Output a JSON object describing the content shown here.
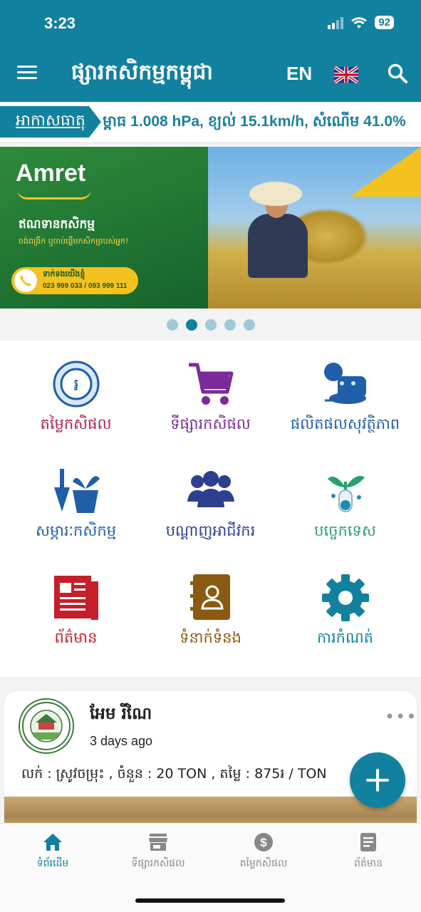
{
  "status_bar": {
    "time": "3:23",
    "battery": "92"
  },
  "header": {
    "title": "ផ្សារកសិកម្មកម្ពុជា",
    "language": "EN"
  },
  "ticker": {
    "label": "អាកាសធាតុ",
    "text": "ម្ពាធ 1.008 hPa, ខ្យល់ 15.1km/h, សំណើម 41.0%"
  },
  "banner": {
    "logo": "Amret",
    "heading": "ឥណទានកសិកម្ម",
    "subheading": "ចង់ពង្រីក ឬចាប់ផ្ដើមកសិកម្មរបស់អ្នក!",
    "call_label": "ទាក់ទងយើងខ្ញុំ",
    "call_numbers": "023 999 033 / 093 999 111",
    "slides": 5,
    "active_slide": 2
  },
  "menu": [
    {
      "label": "តម្លៃកសិផល",
      "color": "#b11f4b"
    },
    {
      "label": "ទីផ្សារកសិផល",
      "color": "#7b2a9a"
    },
    {
      "label": "ផលិតផលសុវត្ថិភាព",
      "color": "#1f5ea8"
    },
    {
      "label": "សម្ភារៈកសិកម្ម",
      "color": "#1f5ea8"
    },
    {
      "label": "បណ្ដាញអាជីវករ",
      "color": "#2d3f8f"
    },
    {
      "label": "បច្ចេកទេស",
      "color": "#27a06e"
    },
    {
      "label": "ព័ត៌មាន",
      "color": "#c41f2a"
    },
    {
      "label": "ទំនាក់ទំនង",
      "color": "#8a5a12"
    },
    {
      "label": "ការកំណត់",
      "color": "#11819f"
    }
  ],
  "post": {
    "author": "អែម រីណៃ",
    "time": "3 days ago",
    "content": "លក់ : ស្រូវចម្រុះ , ចំនួន : 20 TON , តម្លៃ : 875៛ / TON",
    "more": "•••"
  },
  "bottom_nav": [
    {
      "label": "ទំព័រដើម",
      "active": true
    },
    {
      "label": "ទីផ្សារកសិផល",
      "active": false
    },
    {
      "label": "តម្លៃកសិផល",
      "active": false
    },
    {
      "label": "ព័ត៌មាន",
      "active": false
    }
  ],
  "colors": {
    "primary": "#11819f",
    "accent": "#f3c21f"
  }
}
